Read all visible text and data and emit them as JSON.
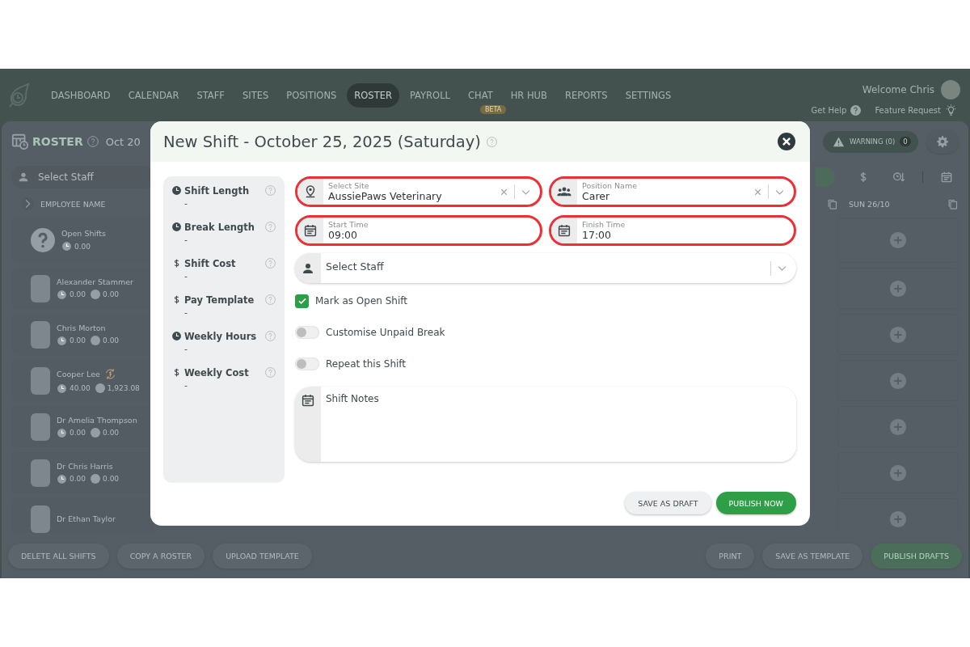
{
  "nav": {
    "items": [
      {
        "label": "DASHBOARD",
        "selected": false
      },
      {
        "label": "CALENDAR",
        "selected": false
      },
      {
        "label": "STAFF",
        "selected": false
      },
      {
        "label": "SITES",
        "selected": false
      },
      {
        "label": "POSITIONS",
        "selected": false
      },
      {
        "label": "ROSTER",
        "selected": true
      },
      {
        "label": "PAYROLL",
        "selected": false
      },
      {
        "label": "CHAT",
        "selected": false,
        "badge": "BETA"
      },
      {
        "label": "HR HUB",
        "selected": false
      },
      {
        "label": "REPORTS",
        "selected": false
      },
      {
        "label": "SETTINGS",
        "selected": false
      }
    ],
    "welcome": "Welcome Chris",
    "help_link": "Get Help",
    "feature_link": "Feature Request"
  },
  "roster": {
    "title": "ROSTER",
    "date": "Oct 20",
    "warning": {
      "label": "WARNING (0)",
      "count": "0"
    },
    "staff_filter": {
      "placeholder": "Select Staff"
    },
    "columns": [
      "EMPLOYEE NAME",
      "SUN 26/10"
    ],
    "rows": [
      {
        "kind": "open",
        "name": "Open Shifts",
        "hours": "0.00"
      },
      {
        "kind": "staff",
        "name": "Alexander Stammer",
        "hours": "0.00",
        "cost": "0.00",
        "pay_alert": false
      },
      {
        "kind": "staff",
        "name": "Chris Morton",
        "hours": "0.00",
        "cost": "0.00",
        "pay_alert": false
      },
      {
        "kind": "staff",
        "name": "Cooper Lee",
        "hours": "40.00",
        "cost": "1,923.08",
        "pay_alert": true
      },
      {
        "kind": "staff",
        "name": "Dr Amelia Thompson",
        "hours": "0.00",
        "cost": "0.00",
        "pay_alert": false
      },
      {
        "kind": "staff",
        "name": "Dr Chris Harris",
        "hours": "0.00",
        "cost": "0.00",
        "pay_alert": false
      },
      {
        "kind": "staff",
        "name": "Dr Ethan Taylor",
        "pay_alert": false
      }
    ]
  },
  "footer": {
    "left": [
      {
        "label": "DELETE ALL SHIFTS",
        "kind": "plain"
      },
      {
        "label": "COPY A ROSTER",
        "kind": "plain"
      },
      {
        "label": "UPLOAD TEMPLATE",
        "kind": "plain"
      }
    ],
    "right": [
      {
        "label": "PRINT",
        "kind": "plain"
      },
      {
        "label": "SAVE AS TEMPLATE",
        "kind": "plain"
      },
      {
        "label": "PUBLISH DRAFTS",
        "kind": "primary"
      }
    ]
  },
  "modal": {
    "title": "New Shift - October 25, 2025 (Saturday)",
    "summary": [
      {
        "kind": "time",
        "label": "Shift Length",
        "value": "-"
      },
      {
        "kind": "time",
        "label": "Break Length",
        "value": "-"
      },
      {
        "kind": "money",
        "label": "Shift Cost",
        "value": "-"
      },
      {
        "kind": "money",
        "label": "Pay Template",
        "value": "-"
      },
      {
        "kind": "time",
        "label": "Weekly Hours",
        "value": "-"
      },
      {
        "kind": "money",
        "label": "Weekly Cost",
        "value": "-"
      }
    ],
    "fields": [
      {
        "kind": "select",
        "label": "Select Site",
        "value": "AussiePaws Veterinary",
        "highlighted": true
      },
      {
        "kind": "select",
        "label": "Position Name",
        "value": "Carer",
        "highlighted": true
      },
      {
        "kind": "time",
        "label": "Start Time",
        "value": "09:00",
        "highlighted": true
      },
      {
        "kind": "time",
        "label": "Finish Time",
        "value": "17:00",
        "highlighted": true
      }
    ],
    "staff": {
      "placeholder": "Select Staff"
    },
    "options": [
      {
        "kind": "checkbox",
        "label": "Mark as Open Shift",
        "on": true
      },
      {
        "kind": "toggle",
        "label": "Customise Unpaid Break",
        "on": false
      },
      {
        "kind": "toggle",
        "label": "Repeat this Shift",
        "on": false
      }
    ],
    "notes": {
      "placeholder": "Shift Notes"
    },
    "buttons": [
      {
        "label": "SAVE AS DRAFT",
        "kind": "secondary"
      },
      {
        "label": "PUBLISH NOW",
        "kind": "primary"
      }
    ]
  }
}
